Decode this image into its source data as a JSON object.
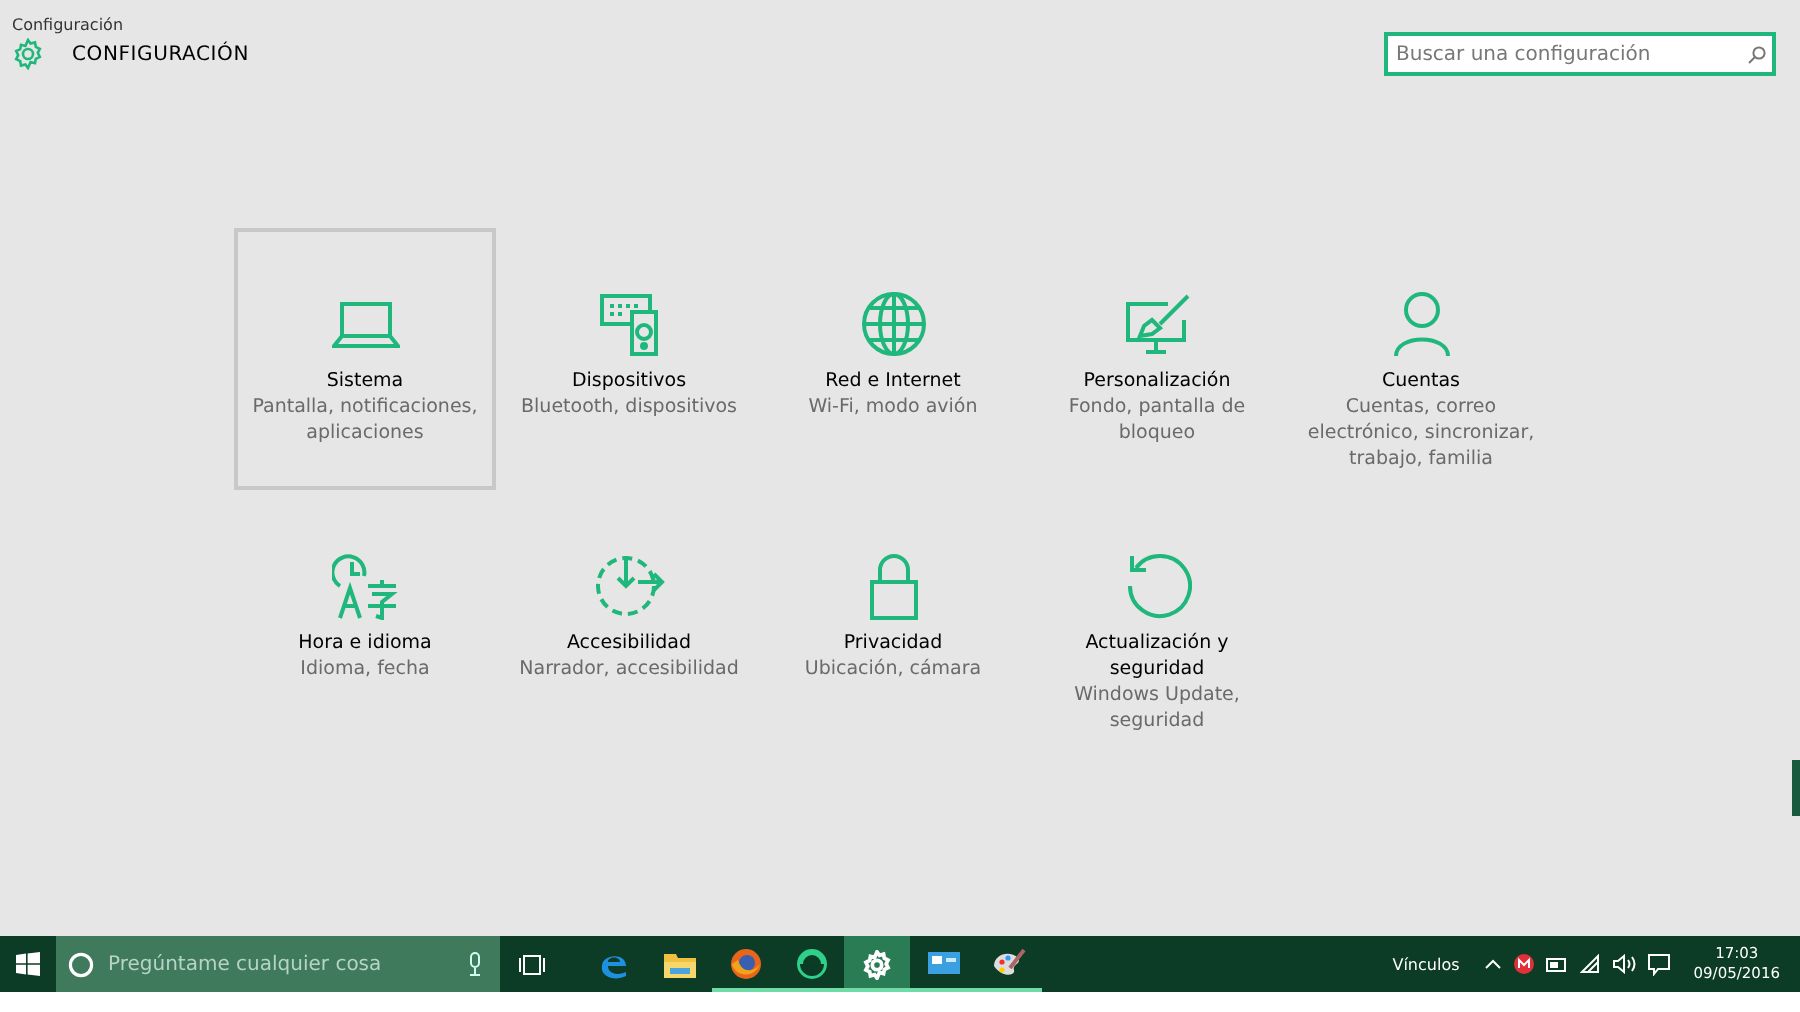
{
  "window": {
    "title": "Configuración",
    "heading": "CONFIGURACIÓN"
  },
  "search": {
    "placeholder": "Buscar una configuración"
  },
  "tiles": [
    {
      "title": "Sistema",
      "subtitle": "Pantalla, notificaciones, aplicaciones",
      "selected": true
    },
    {
      "title": "Dispositivos",
      "subtitle": "Bluetooth, dispositivos",
      "selected": false
    },
    {
      "title": "Red e Internet",
      "subtitle": "Wi-Fi, modo avión",
      "selected": false
    },
    {
      "title": "Personalización",
      "subtitle": "Fondo, pantalla de bloqueo",
      "selected": false
    },
    {
      "title": "Cuentas",
      "subtitle": "Cuentas, correo electrónico, sincronizar, trabajo, familia",
      "selected": false
    },
    {
      "title": "Hora e idioma",
      "subtitle": "Idioma, fecha",
      "selected": false
    },
    {
      "title": "Accesibilidad",
      "subtitle": "Narrador, accesibilidad",
      "selected": false
    },
    {
      "title": "Privacidad",
      "subtitle": "Ubicación, cámara",
      "selected": false
    },
    {
      "title": "Actualización y seguridad",
      "subtitle": "Windows Update, seguridad",
      "selected": false
    }
  ],
  "taskbar": {
    "search_placeholder": "Pregúntame cualquier cosa",
    "apps": [
      {
        "kind": "edge",
        "selected": false,
        "running": false
      },
      {
        "kind": "folder",
        "selected": false,
        "running": false
      },
      {
        "kind": "firefox",
        "selected": false,
        "running": true
      },
      {
        "kind": "app",
        "selected": false,
        "running": true
      },
      {
        "kind": "settings",
        "selected": true,
        "running": true
      },
      {
        "kind": "monitor",
        "selected": false,
        "running": true
      },
      {
        "kind": "paint",
        "selected": false,
        "running": true
      }
    ],
    "links_label": "Vínculos",
    "time": "17:03",
    "date": "09/05/2016"
  }
}
